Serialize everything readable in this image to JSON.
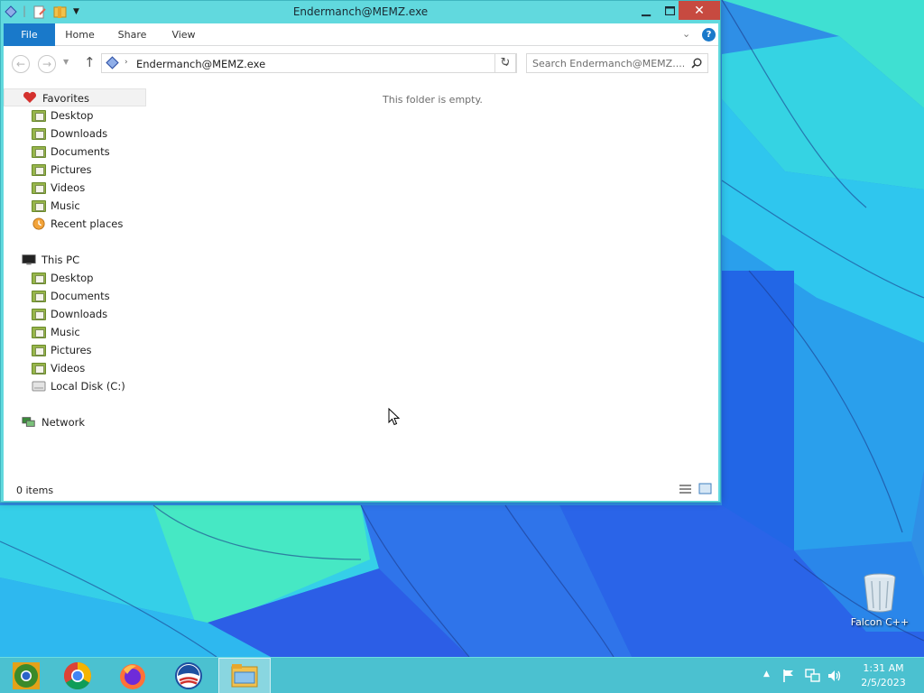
{
  "window": {
    "title": "Endermanch@MEMZ.exe",
    "ribbon_tabs": [
      "File",
      "Home",
      "Share",
      "View"
    ],
    "address_path": "Endermanch@MEMZ.exe",
    "search_placeholder": "Search Endermanch@MEMZ....",
    "empty_message": "This folder is empty.",
    "status": "0 items"
  },
  "navpane": {
    "favorites_label": "Favorites",
    "favorites": [
      "Desktop",
      "Downloads",
      "Documents",
      "Pictures",
      "Videos",
      "Music",
      "Recent places"
    ],
    "thispc_label": "This PC",
    "thispc": [
      "Desktop",
      "Documents",
      "Downloads",
      "Music",
      "Pictures",
      "Videos",
      "Local Disk (C:)"
    ],
    "network_label": "Network"
  },
  "desktop": {
    "recycle_bin_label": "Falcon C++"
  },
  "taskbar": {
    "apps": [
      "chrome-canary-icon",
      "chrome-icon",
      "firefox-icon",
      "obama-icon",
      "file-explorer-icon"
    ],
    "time": "1:31 AM",
    "date": "2/5/2023"
  },
  "colors": {
    "accent": "#1979ca",
    "titlebar": "#61d9de",
    "close": "#c74a40"
  }
}
